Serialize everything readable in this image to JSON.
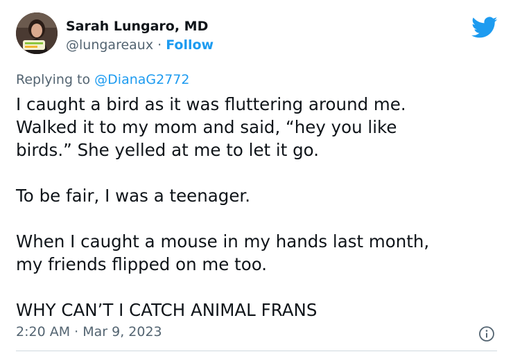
{
  "colors": {
    "accent": "#1d9bf0",
    "text_primary": "#0f1419",
    "text_secondary": "#536471",
    "divider": "#cfd9de"
  },
  "author": {
    "display_name": "Sarah Lungaro, MD",
    "handle": "@lungareaux",
    "separator": " · ",
    "follow_label": "Follow",
    "avatar_icon": "profile-photo"
  },
  "header": {
    "logo_icon": "twitter-bird-icon"
  },
  "reply": {
    "prefix": "Replying to ",
    "handle": "@DianaG2772"
  },
  "tweet": {
    "lines": [
      "I caught a bird as it was fluttering around me.",
      "Walked it to my mom and said, “hey you like",
      "birds.” She yelled at me to let it go.",
      "To be fair, I was a teenager.",
      "When I caught a mouse in my hands last month,",
      "my friends flipped on me too.",
      "WHY CAN’T I CATCH ANIMAL FRANS"
    ]
  },
  "footer": {
    "timestamp": "2:20 AM · Mar 9, 2023",
    "info_icon": "info-icon"
  }
}
